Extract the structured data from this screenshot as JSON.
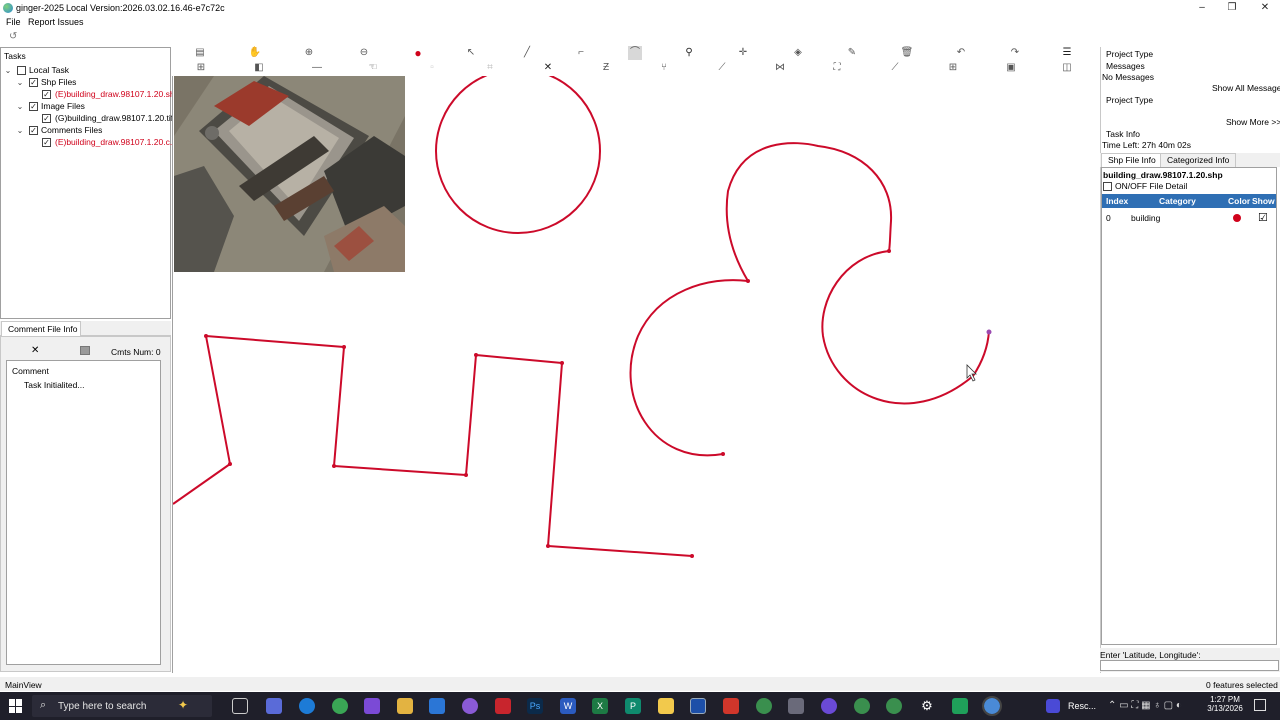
{
  "window": {
    "title": "ginger-2025",
    "version": "Local Version:2026.03.02.16.46-e7c72c",
    "minimize": "–",
    "maximize": "❐",
    "close": "✕"
  },
  "menu": {
    "file": "File",
    "report": "Report Issues"
  },
  "quickbar": {
    "refresh_icon": "↺"
  },
  "tasks": {
    "title": "Tasks",
    "local_task": "Local Task",
    "shp_files": "Shp Files",
    "shp_item": "(E)building_draw.98107.1.20.shp",
    "image_files": "Image Files",
    "image_item": "(G)building_draw.98107.1.20.tif",
    "comments_files": "Comments Files",
    "comments_item": "(E)building_draw.98107.1.20.c..."
  },
  "comment_panel": {
    "tab": "Comment File Info",
    "close_icon": "✕",
    "cmts_label": "Cmts Num:",
    "cmts_num": "0",
    "header": "Comment",
    "entry": "Task Initialited..."
  },
  "toolbar": {
    "row1": [
      "save-icon",
      "pan-icon",
      "zoom-in-icon",
      "zoom-out-icon",
      "record-icon",
      "select-icon",
      "line-icon",
      "corner-icon",
      "curve-icon",
      "pin-icon",
      "vertex-icon",
      "fill-icon",
      "edit-icon",
      "delete-icon",
      "undo-icon",
      "redo-icon",
      "menu-icon"
    ],
    "row2": [
      "grid-icon",
      "layer-icon",
      "minus-icon",
      "hand-icon",
      "disabled-icon",
      "crop-icon",
      "cut-icon",
      "zigzag-icon",
      "split-icon",
      "graph-icon",
      "merge-icon",
      "extent-icon",
      "draw-icon",
      "add-icon",
      "frame-icon",
      "panel-icon"
    ]
  },
  "right_panel": {
    "project_type": "Project Type",
    "messages": "Messages",
    "no_messages": "No Messages",
    "show_all": "Show All Messages",
    "project_type2": "Project Type",
    "show_more": "Show More >>",
    "task_info": "Task Info",
    "time_left": "Time Left: 27h 40m 02s",
    "tab_shp": "Shp File Info",
    "tab_cat": "Categorized Info",
    "file_name": "building_draw.98107.1.20.shp",
    "onoff": "ON/OFF File Detail",
    "columns": {
      "index": "Index",
      "category": "Category",
      "color": "Color",
      "show": "Show"
    },
    "rows": [
      {
        "index": "0",
        "category": "building",
        "color": "#d0021b",
        "show": "☑"
      }
    ],
    "latlon_label": "Enter 'Latitude, Longitude':"
  },
  "status": {
    "left": "MainView",
    "right": "0 features selected"
  },
  "taskbar": {
    "search_placeholder": "Type here to search",
    "time": "1:27 PM",
    "date": "3/13/2026",
    "resc": "Resc..."
  },
  "colors": {
    "stroke": "#cc0a2a",
    "accent": "#2f6fb4",
    "taskbar": "#1f1f2a"
  }
}
